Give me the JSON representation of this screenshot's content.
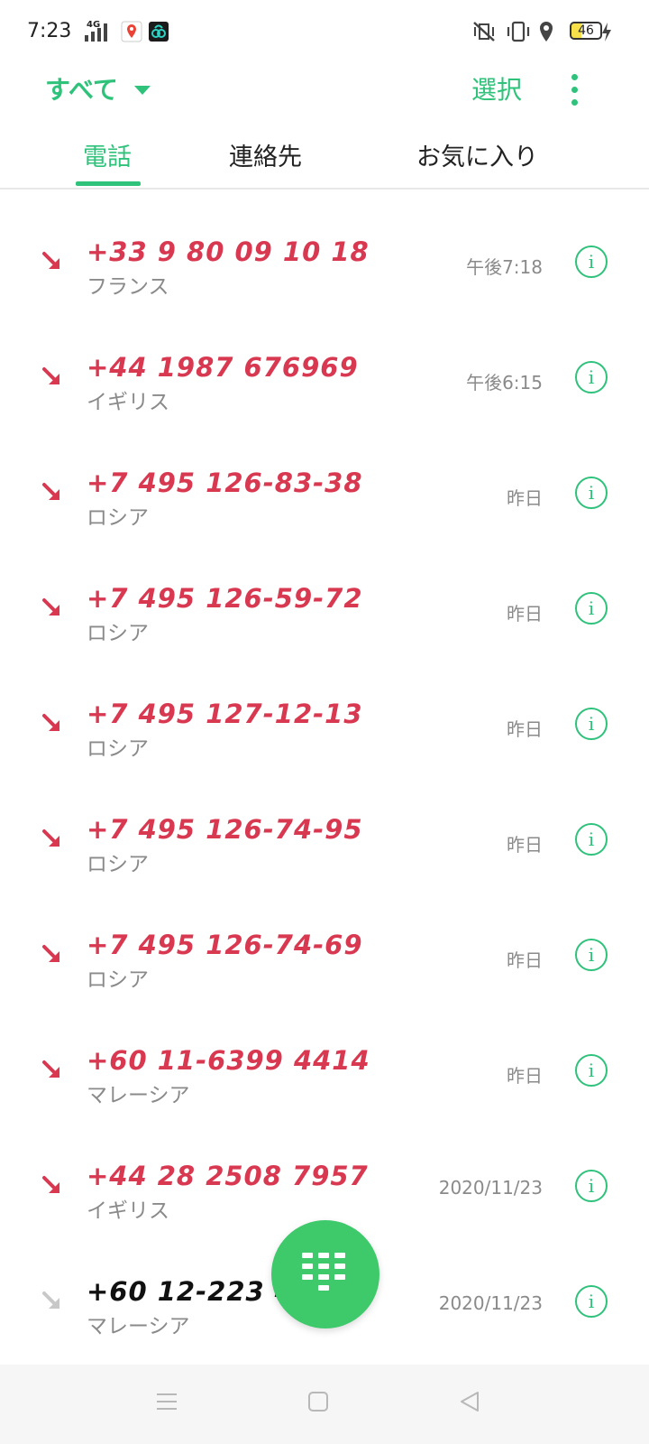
{
  "status_bar": {
    "time": "7:23",
    "network_label": "4G",
    "battery": "46",
    "icons": [
      "signal-icon",
      "maps-icon",
      "app-icon",
      "vibrate-icon",
      "mute-icon",
      "location-icon",
      "battery-icon",
      "charging-icon"
    ]
  },
  "header": {
    "filter_label": "すべて",
    "select_label": "選択"
  },
  "tabs": [
    "電話",
    "連絡先",
    "お気に入り"
  ],
  "calls": [
    {
      "number": "+33 9 80 09 10 18",
      "location": "フランス",
      "time": "午後7:18",
      "type": "missed"
    },
    {
      "number": "+44 1987 676969",
      "location": "イギリス",
      "time": "午後6:15",
      "type": "missed"
    },
    {
      "number": "+7 495 126-83-38",
      "location": "ロシア",
      "time": "昨日",
      "type": "missed"
    },
    {
      "number": "+7 495 126-59-72",
      "location": "ロシア",
      "time": "昨日",
      "type": "missed"
    },
    {
      "number": "+7 495 127-12-13",
      "location": "ロシア",
      "time": "昨日",
      "type": "missed"
    },
    {
      "number": "+7 495 126-74-95",
      "location": "ロシア",
      "time": "昨日",
      "type": "missed"
    },
    {
      "number": "+7 495 126-74-69",
      "location": "ロシア",
      "time": "昨日",
      "type": "missed"
    },
    {
      "number": "+60 11-6399 4414",
      "location": "マレーシア",
      "time": "昨日",
      "type": "missed"
    },
    {
      "number": "+44 28 2508 7957",
      "location": "イギリス",
      "time": "2020/11/23",
      "type": "missed"
    },
    {
      "number": "+60 12-223 4260",
      "location": "マレーシア",
      "time": "2020/11/23",
      "type": "incoming"
    }
  ],
  "colors": {
    "accent": "#2ec27a",
    "missed": "#d83850",
    "fab": "#3ec96b"
  }
}
